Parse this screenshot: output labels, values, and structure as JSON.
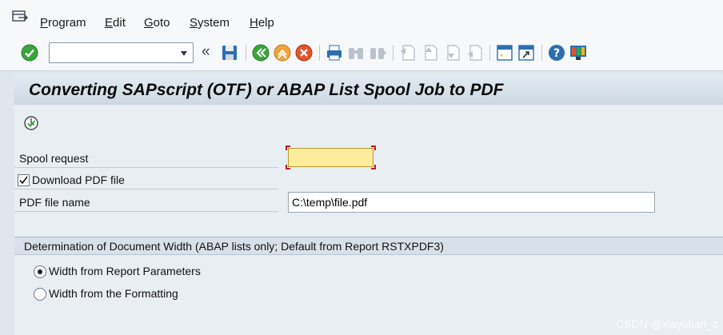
{
  "menu": {
    "items": [
      {
        "mnemonic": "P",
        "rest": "rogram"
      },
      {
        "mnemonic": "E",
        "rest": "dit"
      },
      {
        "mnemonic": "G",
        "rest": "oto"
      },
      {
        "mnemonic": "S",
        "rest": "ystem"
      },
      {
        "mnemonic": "H",
        "rest": "elp"
      }
    ]
  },
  "toolbar": {
    "command_field_value": "",
    "collapse_glyph": "«",
    "icons": [
      "enter-icon",
      "save-icon",
      "back-icon",
      "exit-icon",
      "cancel-icon",
      "print-icon",
      "find-icon",
      "find-next-icon",
      "first-page-icon",
      "previous-page-icon",
      "next-page-icon",
      "last-page-icon",
      "create-session-icon",
      "shortcut-icon",
      "help-icon",
      "customize-layout-icon"
    ]
  },
  "page": {
    "title": "Converting SAPscript (OTF) or ABAP List Spool Job to PDF"
  },
  "form": {
    "spool_request_label": "Spool request",
    "spool_request_value": "",
    "download_pdf_label": "Download PDF file",
    "download_pdf_checked": true,
    "pdf_file_name_label": "PDF file name",
    "pdf_file_name_value": "C:\\temp\\file.pdf"
  },
  "group": {
    "title": "Determination of Document Width (ABAP lists only; Default from Report RSTXPDF3)",
    "options": [
      {
        "label": "Width from Report Parameters",
        "selected": true
      },
      {
        "label": "Width from the Formatting",
        "selected": false
      }
    ]
  },
  "colors": {
    "required_field": "#fcec9c",
    "required_marker": "#c21b1b",
    "enter_green": "#3aa53a"
  },
  "watermark": "CSDN @xiayutian_c"
}
